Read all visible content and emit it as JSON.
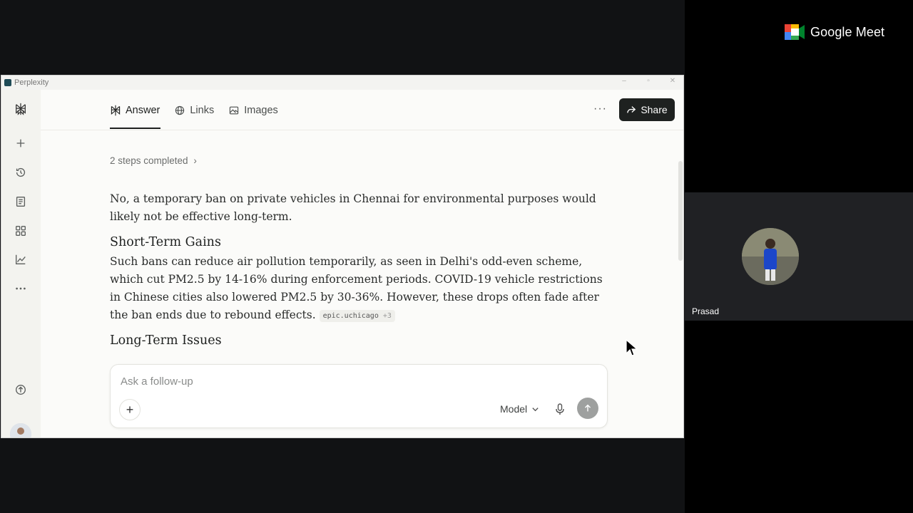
{
  "meet": {
    "brand": "Google Meet",
    "participant_name": "Prasad"
  },
  "window": {
    "app_title": "Perplexity"
  },
  "sidebar": {
    "items": [
      "logo-icon",
      "new-thread-icon",
      "history-icon",
      "library-icon",
      "spaces-icon",
      "finance-icon",
      "more-icon",
      "download-icon"
    ]
  },
  "tabs": [
    {
      "label": "Answer",
      "icon": "answer-icon",
      "active": true
    },
    {
      "label": "Links",
      "icon": "globe-icon",
      "active": false
    },
    {
      "label": "Images",
      "icon": "image-icon",
      "active": false
    }
  ],
  "toolbar": {
    "more_label": "···",
    "share_label": "Share"
  },
  "answer": {
    "steps_label": "2 steps completed",
    "intro": "No, a temporary ban on private vehicles in Chennai for environmental purposes would likely not be effective long-term.",
    "section1_heading": "Short-Term Gains",
    "section1_text": "Such bans can reduce air pollution temporarily, as seen in Delhi's odd-even scheme, which cut PM2.5 by 14-16% during enforcement periods. COVID-19 vehicle restrictions in Chinese cities also lowered PM2.5 by 30-36%. However, these drops often fade after the ban ends due to rebound effects.",
    "citation_source": "epic.uchicago",
    "citation_more": "+3",
    "section2_heading": "Long-Term Issues"
  },
  "composer": {
    "placeholder": "Ask a follow-up",
    "plus_label": "+",
    "model_label": "Model"
  },
  "colors": {
    "share_bg": "#1e2120",
    "page_bg": "#fbfbf9",
    "sidebar_bg": "#f3f3ef",
    "meet_tile_bg": "#202124"
  }
}
